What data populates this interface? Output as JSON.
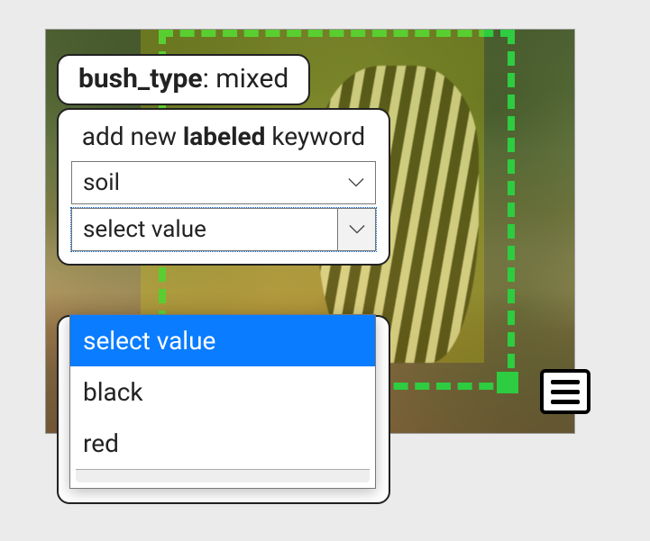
{
  "tag": {
    "key": "bush_type",
    "value": "mixed"
  },
  "panel": {
    "title_prefix": "add new ",
    "title_bold": "labeled",
    "title_suffix": " keyword"
  },
  "keyword_select": {
    "value": "soil"
  },
  "value_select": {
    "placeholder": "select value",
    "options": [
      "select value",
      "black",
      "red"
    ],
    "selected_index": 0
  },
  "icons": {
    "chevron": "chevron-down-icon",
    "menu": "menu-icon"
  }
}
